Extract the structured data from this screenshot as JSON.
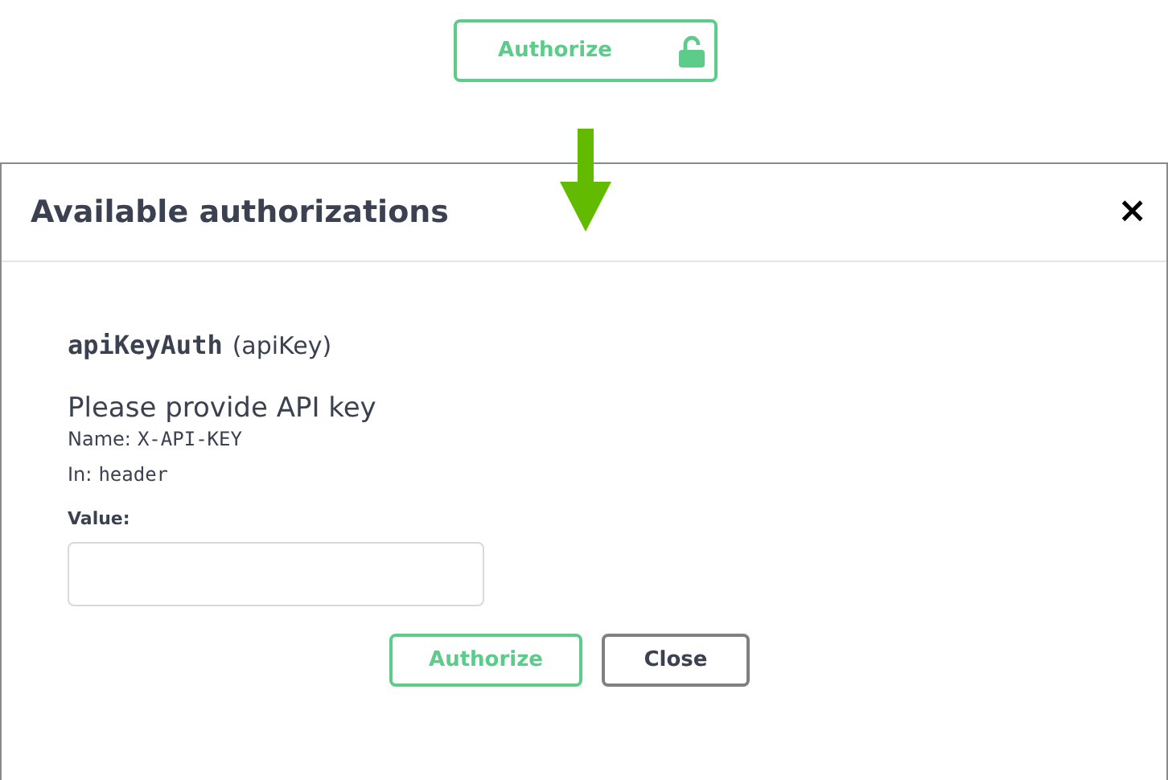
{
  "top_button": {
    "label": "Authorize"
  },
  "modal": {
    "title": "Available authorizations",
    "close": "×",
    "scheme": {
      "name": "apiKeyAuth",
      "type": "(apiKey)",
      "description": "Please provide API key",
      "name_label": "Name:",
      "name_value": "X-API-KEY",
      "in_label": "In:",
      "in_value": "header",
      "value_label": "Value:"
    },
    "buttons": [
      {
        "label": "Authorize",
        "kind": "primary"
      },
      {
        "label": "Close",
        "kind": "secondary"
      }
    ]
  }
}
